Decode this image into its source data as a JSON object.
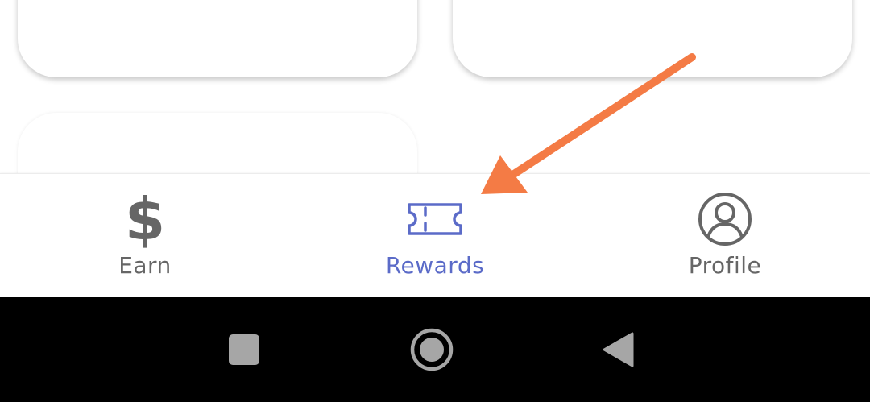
{
  "bottom_nav": {
    "items": [
      {
        "label": "Earn",
        "icon": "dollar-icon",
        "active": false
      },
      {
        "label": "Rewards",
        "icon": "ticket-icon",
        "active": true
      },
      {
        "label": "Profile",
        "icon": "profile-icon",
        "active": false
      }
    ],
    "dollar_symbol": "$"
  },
  "system_nav": {
    "icons": [
      "recents-icon",
      "home-icon",
      "back-icon"
    ]
  },
  "colors": {
    "active": "#5B6BC8",
    "inactive": "#666666",
    "arrow": "#F47B45",
    "system_icons": "#A6A6A6",
    "system_bar": "#000000"
  }
}
